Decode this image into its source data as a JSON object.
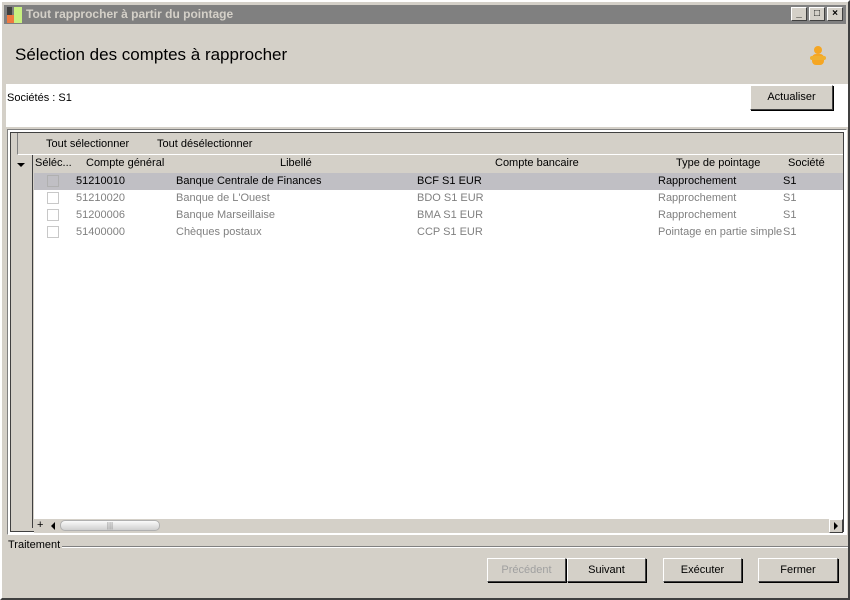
{
  "window": {
    "title": "Tout rapprocher à partir du pointage",
    "controls": [
      "_",
      "□",
      "×"
    ]
  },
  "header": {
    "title": "Sélection des comptes à rapprocher",
    "icon": "person-icon"
  },
  "filter": {
    "societes_label": "Sociétés : S1",
    "refresh_label": "Actualiser"
  },
  "toolbar": {
    "select_all": "Tout sélectionner",
    "deselect_all": "Tout désélectionner"
  },
  "grid": {
    "columns": [
      "Séléc...",
      "Compte général",
      "Libellé",
      "Compte bancaire",
      "Type de pointage",
      "Société"
    ],
    "rows": [
      {
        "selected": false,
        "highlighted": true,
        "compte": "51210010",
        "libelle": "Banque Centrale de Finances",
        "bancaire": "BCF S1 EUR",
        "type": "Rapprochement",
        "societe": "S1"
      },
      {
        "selected": false,
        "highlighted": false,
        "compte": "51210020",
        "libelle": "Banque de L'Ouest",
        "bancaire": "BDO S1 EUR",
        "type": "Rapprochement",
        "societe": "S1"
      },
      {
        "selected": false,
        "highlighted": false,
        "compte": "51200006",
        "libelle": "Banque Marseillaise",
        "bancaire": "BMA S1 EUR",
        "type": "Rapprochement",
        "societe": "S1"
      },
      {
        "selected": false,
        "highlighted": false,
        "compte": "51400000",
        "libelle": "Chèques postaux",
        "bancaire": "CCP S1 EUR",
        "type": "Pointage en partie simple",
        "societe": "S1"
      }
    ],
    "add_label": "+"
  },
  "footer": {
    "section_label": "Traitement",
    "previous": "Précédent",
    "next": "Suivant",
    "execute": "Exécuter",
    "close": "Fermer"
  }
}
